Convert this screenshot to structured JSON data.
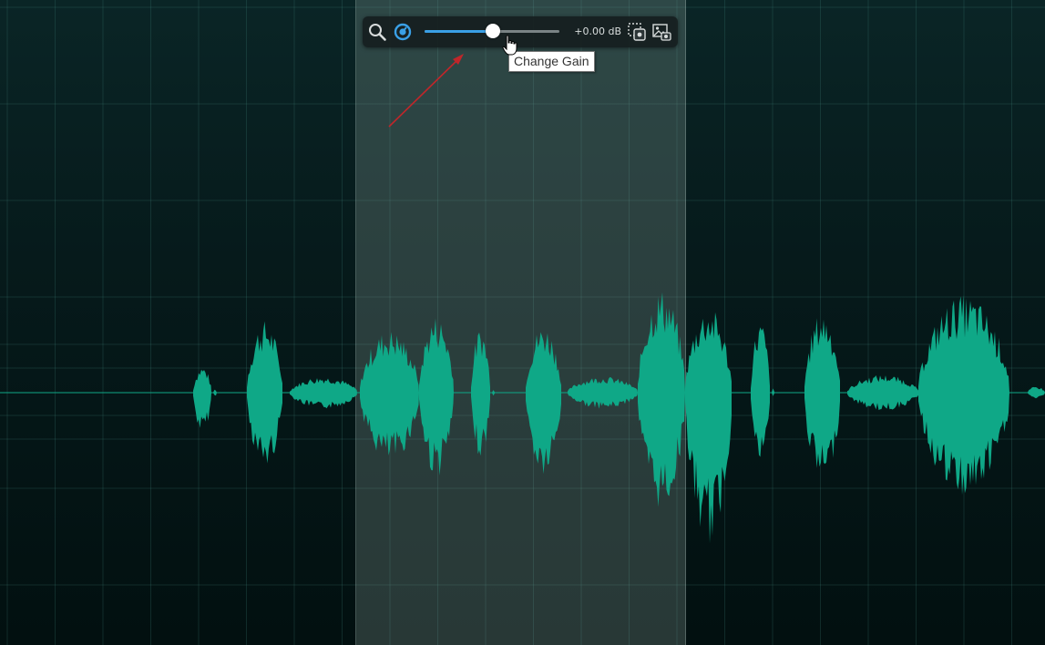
{
  "editor": {
    "accent_color": "#3aa0e6",
    "waveform_color": "#0fa887",
    "selection_color": "#96afa5"
  },
  "toolbar": {
    "icons": {
      "zoom": "magnifier-icon",
      "gain_knob": "gain-knob-icon",
      "selection_clip": "selection-clip-icon",
      "screenshot": "image-capture-icon"
    },
    "gain_slider": {
      "value_fraction": 0.51
    },
    "gain_value": "+0.00 dB"
  },
  "tooltip": {
    "text": "Change Gain"
  },
  "annotation": {
    "arrow_color": "#c0262a"
  }
}
